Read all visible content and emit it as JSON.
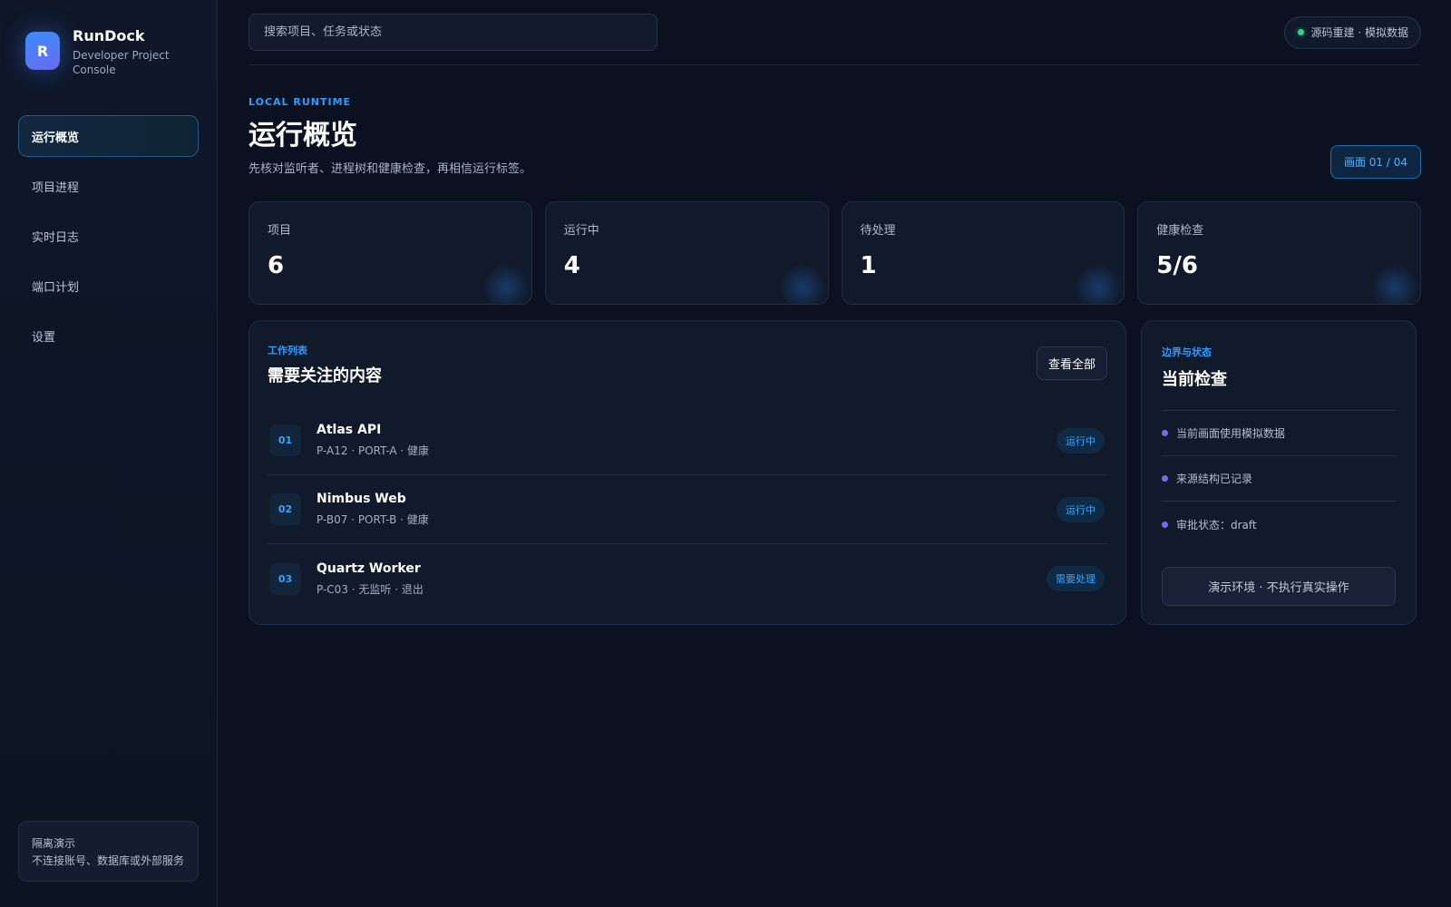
{
  "brand": {
    "logo_letter": "R",
    "name": "RunDock",
    "subtitle": "Developer Project Console"
  },
  "sidebar": {
    "items": [
      {
        "label": "运行概览",
        "active": true
      },
      {
        "label": "项目进程"
      },
      {
        "label": "实时日志"
      },
      {
        "label": "端口计划"
      },
      {
        "label": "设置"
      }
    ],
    "sandbox": {
      "title": "隔离演示",
      "text": "不连接账号、数据库或外部服务"
    }
  },
  "topbar": {
    "search_placeholder": "搜索项目、任务或状态",
    "status": "源码重建 · 模拟数据",
    "status_color": "#2fd483"
  },
  "header": {
    "eyebrow": "LOCAL RUNTIME",
    "title": "运行概览",
    "description": "先核对监听者、进程树和健康检查，再相信运行标签。",
    "screen_badge": "画面 01 / 04"
  },
  "stats": [
    {
      "label": "项目",
      "value": "6"
    },
    {
      "label": "运行中",
      "value": "4"
    },
    {
      "label": "待处理",
      "value": "1"
    },
    {
      "label": "健康检查",
      "value": "5/6"
    }
  ],
  "worklist": {
    "eyebrow": "工作列表",
    "title": "需要关注的内容",
    "view_all": "查看全部",
    "rows": [
      {
        "num": "01",
        "name": "Atlas API",
        "meta": "P-A12 · PORT-A · 健康",
        "tag": "运行中"
      },
      {
        "num": "02",
        "name": "Nimbus Web",
        "meta": "P-B07 · PORT-B · 健康",
        "tag": "运行中"
      },
      {
        "num": "03",
        "name": "Quartz Worker",
        "meta": "P-C03 · 无监听 · 退出",
        "tag": "需要处理"
      }
    ]
  },
  "checks": {
    "eyebrow": "边界与状态",
    "title": "当前检查",
    "items": [
      "当前画面使用模拟数据",
      "来源结构已记录",
      "审批状态：draft"
    ],
    "demo_button": "演示环境 · 不执行真实操作"
  },
  "colors": {
    "accent": "#2e9bff",
    "background": "#0b1120",
    "panel": "#111a2b",
    "purple_dot": "#7b67f0"
  }
}
